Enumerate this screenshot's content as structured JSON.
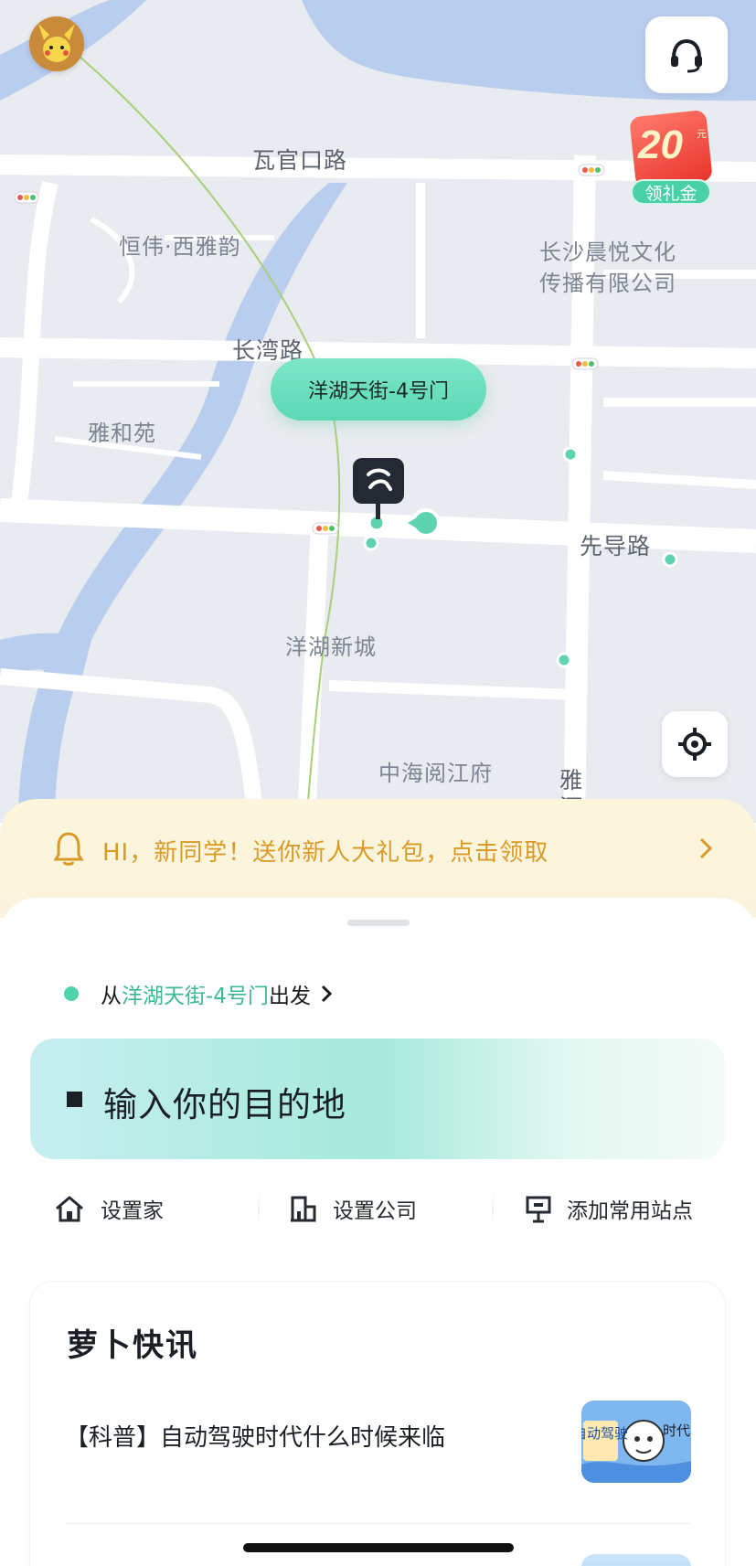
{
  "map": {
    "labels": {
      "waguankou_road": "瓦官口路",
      "hengwei": "恒伟·西雅韵",
      "changsha_company_line1": "长沙晨悦文化",
      "changsha_company_line2": "传播有限公司",
      "changwan_road": "长湾路",
      "yahe_yuan": "雅和苑",
      "xiandao_road": "先导路",
      "yanghu_xincheng": "洋湖新城",
      "zhonghai": "中海阅江府",
      "ya": "雅",
      "he": "河"
    },
    "pickup_bubble": "洋湖天街-4号门",
    "gift_badge": {
      "amount": "20",
      "unit": "元",
      "label": "领礼金"
    }
  },
  "promo": {
    "text": "HI，新同学！送你新人大礼包，点击领取"
  },
  "origin": {
    "prefix": "从",
    "place": "洋湖天街-4号门",
    "suffix": "出发"
  },
  "destination": {
    "placeholder": "输入你的目的地"
  },
  "shortcuts": [
    {
      "label": "设置家",
      "icon": "home-icon"
    },
    {
      "label": "设置公司",
      "icon": "office-icon"
    },
    {
      "label": "添加常用站点",
      "icon": "station-icon"
    }
  ],
  "news": {
    "title": "萝卜快讯",
    "items": [
      {
        "text": "【科普】自动驾驶时代什么时候来临",
        "thumb_text_left": "自动驾驶",
        "thumb_text_right": "时代"
      }
    ]
  },
  "colors": {
    "accent": "#4fd3ab",
    "promo_text": "#d99b25",
    "map_bg": "#e8ebef",
    "water": "#b9cdee"
  }
}
